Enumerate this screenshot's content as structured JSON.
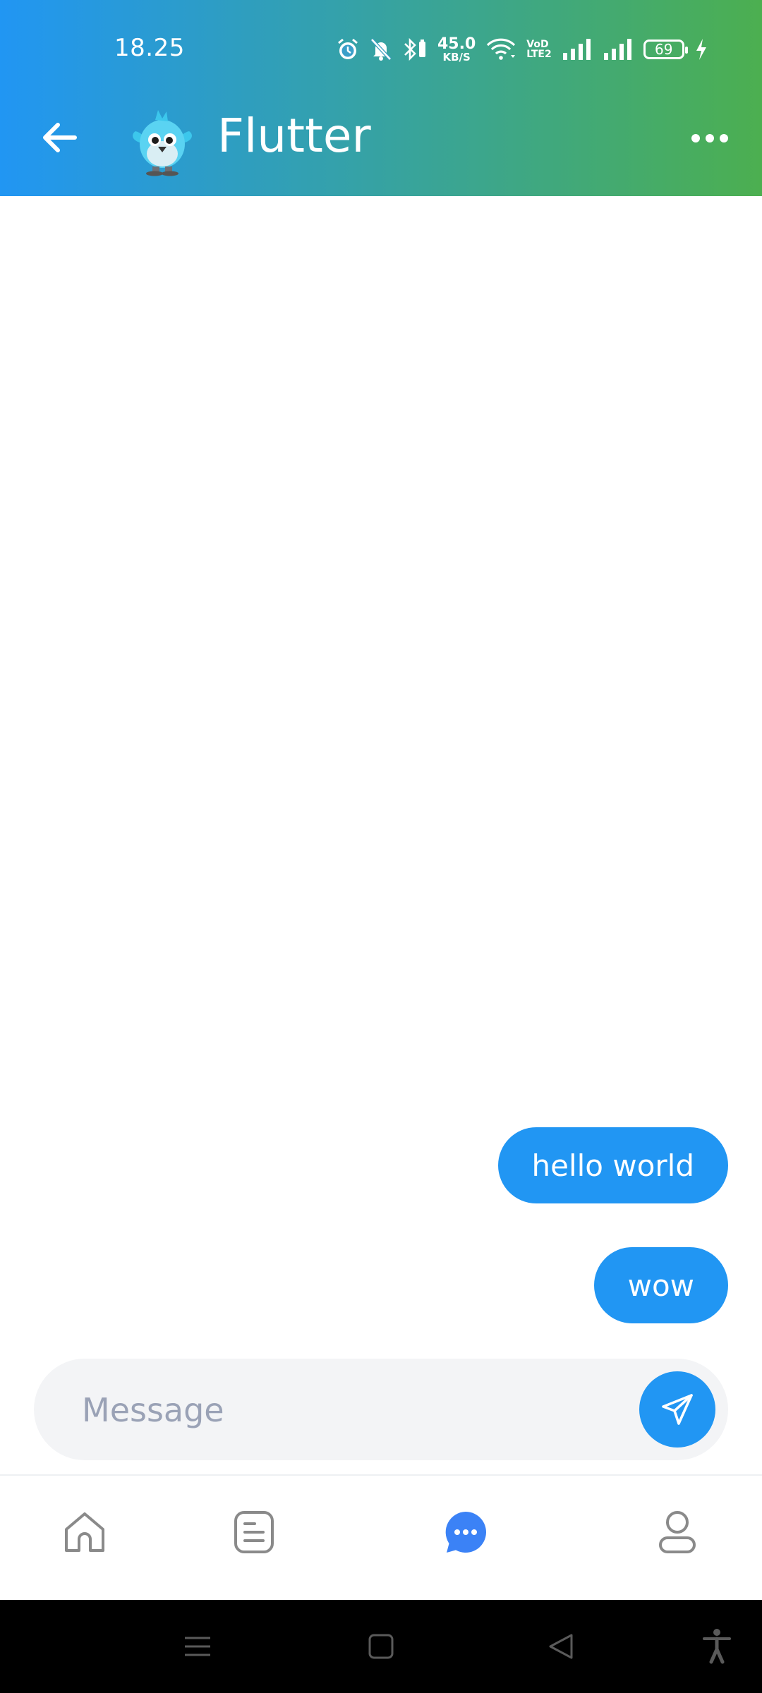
{
  "status_bar": {
    "time": "18.25",
    "net_speed_value": "45.0",
    "net_speed_unit": "KB/S",
    "volte_top": "VoD",
    "volte_bottom": "LTE2",
    "battery_level": "69"
  },
  "app_bar": {
    "title": "Flutter",
    "back_icon": "arrow-left-icon",
    "more_icon": "more-horizontal-icon"
  },
  "messages": [
    {
      "text": "hello world",
      "sender": "me"
    },
    {
      "text": "wow",
      "sender": "me"
    }
  ],
  "composer": {
    "placeholder": "Message",
    "send_icon": "send-icon"
  },
  "bottom_nav": {
    "items": [
      {
        "icon": "home-icon",
        "active": false
      },
      {
        "icon": "document-icon",
        "active": false
      },
      {
        "icon": "chat-icon",
        "active": true
      },
      {
        "icon": "profile-icon",
        "active": false
      }
    ]
  },
  "colors": {
    "gradient_start": "#2196f3",
    "gradient_end": "#4caf50",
    "bubble": "#2196f3",
    "input_bg": "#f3f4f6",
    "placeholder": "#9aa2b6",
    "nav_inactive": "#8a8a8a",
    "nav_active": "#3b82f6"
  }
}
